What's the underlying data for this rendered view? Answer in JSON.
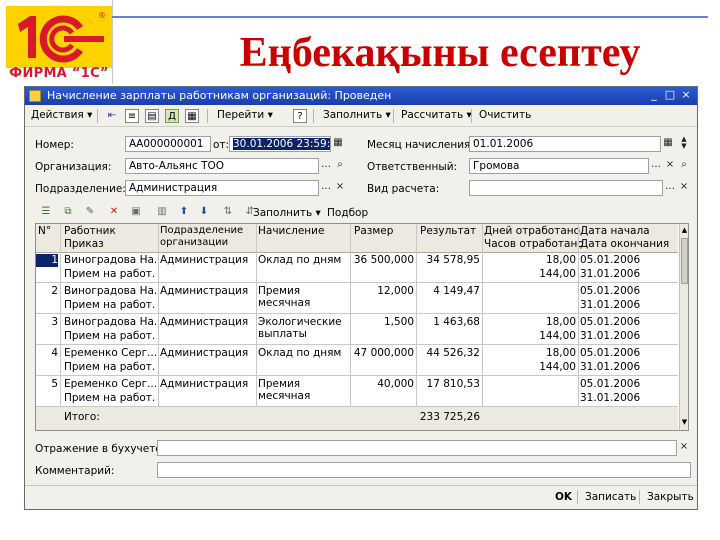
{
  "slide": {
    "title": "Еңбекақыны есептеу",
    "logo_text": "ФИРМА “1С”",
    "logo_mark": "1С"
  },
  "window": {
    "title": "Начисление зарплаты работникам организаций: Проведен",
    "controls": [
      "_",
      "□",
      "×"
    ]
  },
  "toolbar": {
    "actions_label": "Действия",
    "goto_label": "Перейти",
    "fill_label": "Заполнить",
    "calc_label": "Рассчитать",
    "clear_label": "Очистить"
  },
  "form": {
    "number_label": "Номер:",
    "number_value": "АА000000001",
    "date_label": "от:",
    "date_value": "30.01.2006 23:59:59",
    "month_label": "Месяц начисления:",
    "month_value": "01.01.2006",
    "org_label": "Организация:",
    "org_value": "Авто-Альянс ТОО",
    "resp_label": "Ответственный:",
    "resp_value": "Громова",
    "dept_label": "Подразделение:",
    "dept_value": "Администрация",
    "calc_type_label": "Вид расчета:",
    "calc_type_value": ""
  },
  "table_toolbar": {
    "fill_label": "Заполнить",
    "pick_label": "Подбор"
  },
  "table": {
    "headers": {
      "num": "N°",
      "worker": "Работник",
      "order": "Приказ",
      "dept": "Подразделение организации",
      "accrual": "Начисление",
      "size": "Размер",
      "result": "Результат",
      "days": "Дней отработано",
      "hours": "Часов отработано",
      "start": "Дата начала",
      "end": "Дата окончания"
    },
    "rows": [
      {
        "n": "1",
        "worker": "Виноградова На...",
        "order": "Прием на работ...",
        "dept": "Администрация",
        "accrual": "Оклад по дням",
        "size": "36 500,000",
        "result": "34 578,95",
        "days": "18,00",
        "hours": "144,00",
        "start": "05.01.2006",
        "end": "31.01.2006"
      },
      {
        "n": "2",
        "worker": "Виноградова На...",
        "order": "Прием на работ...",
        "dept": "Администрация",
        "accrual": "Премия месячная",
        "size": "12,000",
        "result": "4 149,47",
        "days": "",
        "hours": "",
        "start": "05.01.2006",
        "end": "31.01.2006"
      },
      {
        "n": "3",
        "worker": "Виноградова На...",
        "order": "Прием на работ...",
        "dept": "Администрация",
        "accrual": "Экологические выплаты",
        "size": "1,500",
        "result": "1 463,68",
        "days": "18,00",
        "hours": "144,00",
        "start": "05.01.2006",
        "end": "31.01.2006"
      },
      {
        "n": "4",
        "worker": "Еременко Серг...",
        "order": "Прием на работ...",
        "dept": "Администрация",
        "accrual": "Оклад по дням",
        "size": "47 000,000",
        "result": "44 526,32",
        "days": "18,00",
        "hours": "144,00",
        "start": "05.01.2006",
        "end": "31.01.2006"
      },
      {
        "n": "5",
        "worker": "Еременко Серг...",
        "order": "Прием на работ...",
        "dept": "Администрация",
        "accrual": "Премия месячная",
        "size": "40,000",
        "result": "17 810,53",
        "days": "",
        "hours": "",
        "start": "05.01.2006",
        "end": "31.01.2006"
      }
    ],
    "total_label": "Итого:",
    "total_value": "233 725,26"
  },
  "bottom": {
    "reflect_label": "Отражение в бухучете:",
    "reflect_value": "",
    "comment_label": "Комментарий:",
    "comment_value": ""
  },
  "footer": {
    "ok_label": "OK",
    "save_label": "Записать",
    "close_label": "Закрыть"
  },
  "colors": {
    "title_red": "#c80000",
    "logo_red": "#d7192a",
    "logo_yellow": "#ffd200",
    "window_title_blue": "#1a3ea8",
    "selected_row": "#0a246a"
  }
}
